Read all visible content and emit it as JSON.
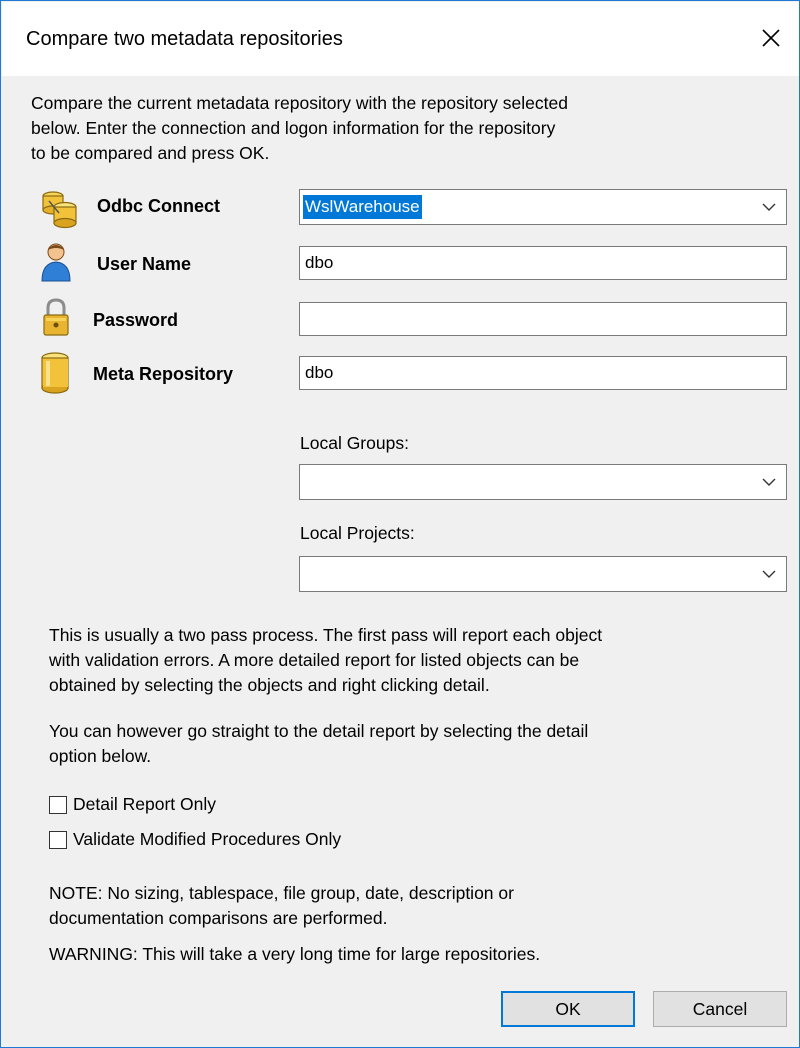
{
  "window": {
    "title": "Compare two metadata repositories"
  },
  "intro_text": "Compare the current metadata repository with the repository selected\nbelow. Enter the connection and logon information for the repository\nto be compared and press OK.",
  "fields": {
    "odbc_label": "Odbc Connect",
    "odbc_value": "WslWarehouse",
    "user_label": "User Name",
    "user_value": "dbo",
    "password_label": "Password",
    "password_value": "",
    "meta_label": "Meta Repository",
    "meta_value": "dbo"
  },
  "local_groups": {
    "label": "Local Groups:",
    "value": ""
  },
  "local_projects": {
    "label": "Local Projects:",
    "value": ""
  },
  "info_text_1": "This is usually a two pass process. The first pass will report each object\nwith validation errors. A more detailed report for listed objects can be\nobtained by selecting the objects and right clicking detail.",
  "info_text_2": "You can however go straight to the detail report by selecting the detail\noption below.",
  "options": {
    "detail_report_label": "Detail Report Only",
    "detail_report_checked": false,
    "validate_modified_label": "Validate Modified Procedures Only",
    "validate_modified_checked": false
  },
  "note_text": "NOTE: No sizing, tablespace, file group, date, description or\ndocumentation comparisons are performed.",
  "warning_text": "WARNING: This will take a very long time for large repositories.",
  "buttons": {
    "ok": "OK",
    "cancel": "Cancel"
  },
  "colors": {
    "accent": "#0078d7",
    "window_border": "#1f7ad4",
    "background": "#f0f0f0"
  }
}
